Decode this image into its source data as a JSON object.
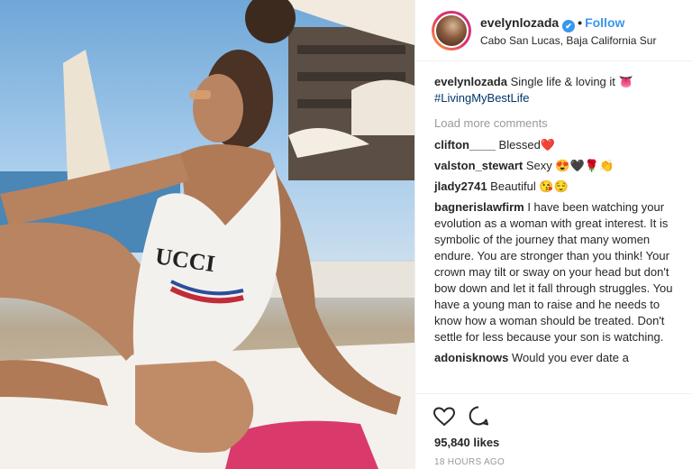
{
  "post": {
    "username": "evelynlozada",
    "verified_badge": "✔",
    "separator": "•",
    "follow_label": "Follow",
    "location": "Cabo San Lucas, Baja California Sur",
    "photo_print": "UCCI"
  },
  "caption": {
    "username": "evelynlozada",
    "text": "Single life & loving it 👅",
    "hashtag": "#LivingMyBestLife"
  },
  "load_more_label": "Load more comments",
  "comments": [
    {
      "user": "clifton____",
      "text": "Blessed❤️"
    },
    {
      "user": "valston_stewart",
      "text": "Sexy 😍🖤🌹👏"
    },
    {
      "user": "jlady2741",
      "text": "Beautiful 😘😌"
    },
    {
      "user": "bagnerislawfirm",
      "text": "I have been watching your evolution as a woman with great interest. It is symbolic of the journey that many women endure. You are stronger than you think! Your crown may tilt or sway on your head but don't bow down and let it fall through struggles. You have a young man to raise and he needs to know how a woman should be treated. Don't settle for less because your son is watching."
    },
    {
      "user": "adonisknows",
      "text": "Would you ever date a"
    }
  ],
  "likes": "95,840 likes",
  "timestamp": "18 HOURS AGO",
  "icons": {
    "like": "heart-icon",
    "comment": "comment-icon"
  },
  "colors": {
    "link": "#3897f0",
    "muted": "#999999",
    "hashtag": "#003569",
    "text": "#262626"
  }
}
